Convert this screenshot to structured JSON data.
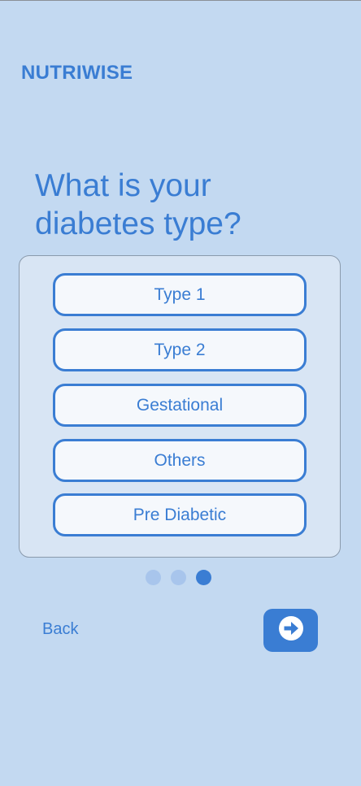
{
  "header": {
    "brand": "NUTRIWISE"
  },
  "main": {
    "question": "What is your diabetes type?",
    "options": [
      {
        "label": "Type 1"
      },
      {
        "label": "Type 2"
      },
      {
        "label": "Gestational"
      },
      {
        "label": "Others"
      },
      {
        "label": "Pre Diabetic"
      }
    ]
  },
  "pagination": {
    "total_steps": 3,
    "current_step": 3
  },
  "footer": {
    "back_label": "Back",
    "next_icon": "arrow-right-icon"
  },
  "colors": {
    "background": "#c3d9f1",
    "accent": "#3a7dd3",
    "card": "#d8e5f4",
    "option_fill": "#f5f8fc",
    "dot_inactive": "#a8c5ec"
  }
}
